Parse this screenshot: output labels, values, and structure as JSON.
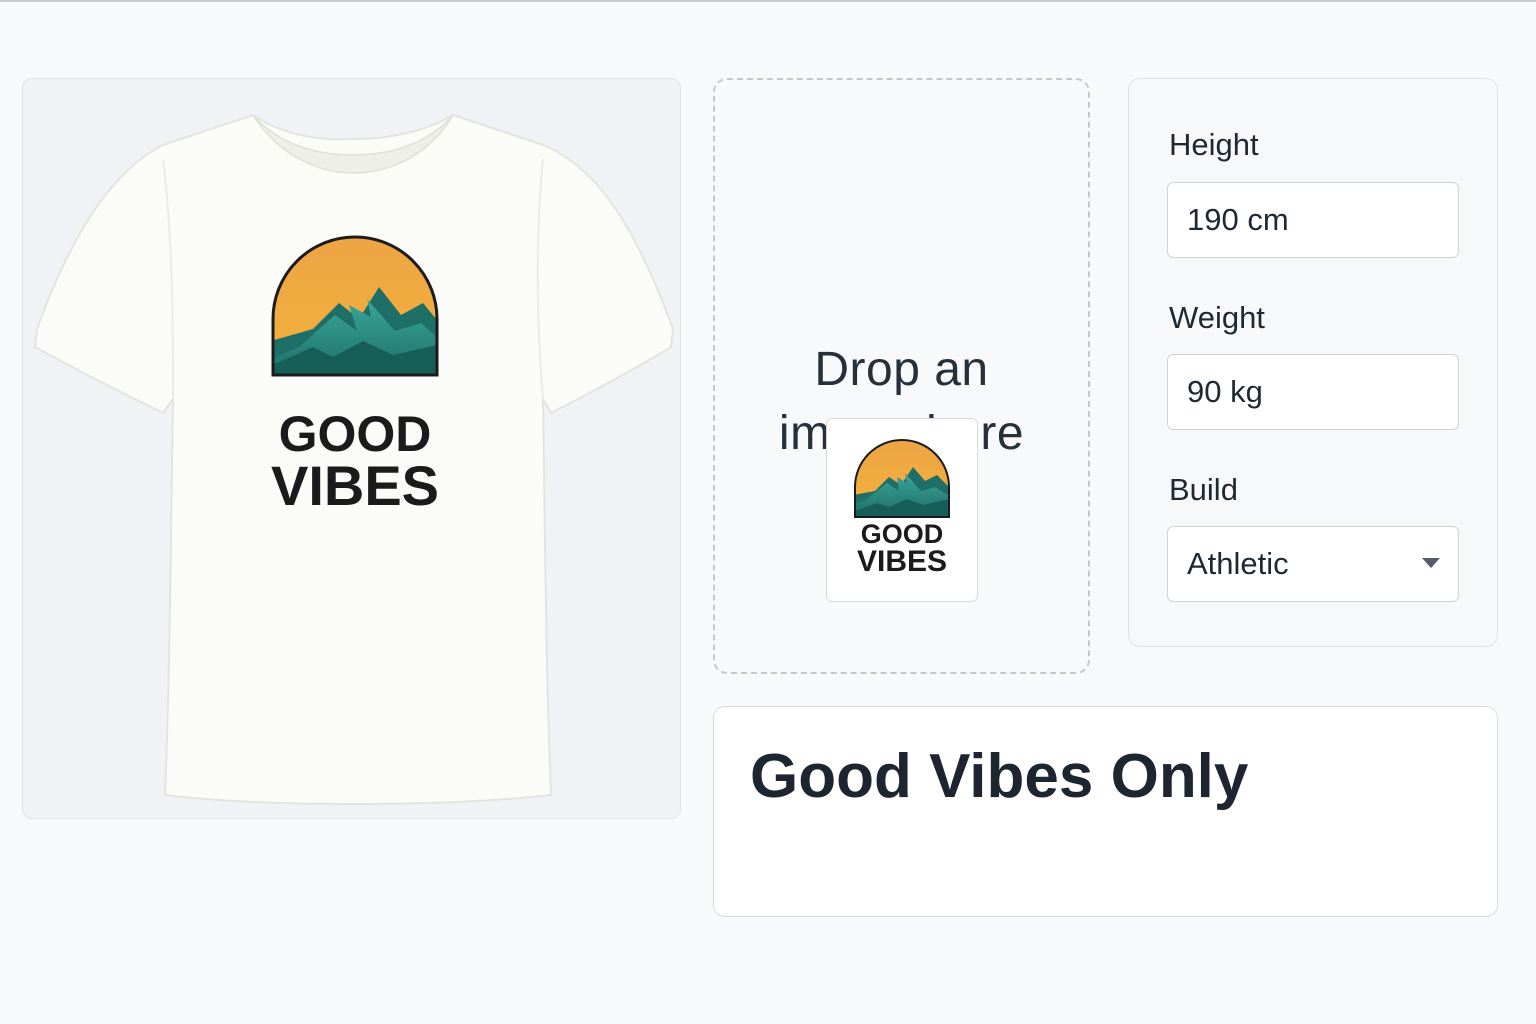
{
  "design": {
    "text_line1": "GOOD",
    "text_line2": "VIBES",
    "sky_color": "#f0a83a",
    "mountain_color": "#1f7a72",
    "outline_color": "#1b1b1b"
  },
  "dropzone": {
    "line1": "Drop an",
    "line2": "image here"
  },
  "measurements": {
    "height_label": "Height",
    "height_value": "190 cm",
    "weight_label": "Weight",
    "weight_value": "90 kg",
    "build_label": "Build",
    "build_value": "Athletic"
  },
  "product": {
    "title": "Good Vibes Only"
  }
}
